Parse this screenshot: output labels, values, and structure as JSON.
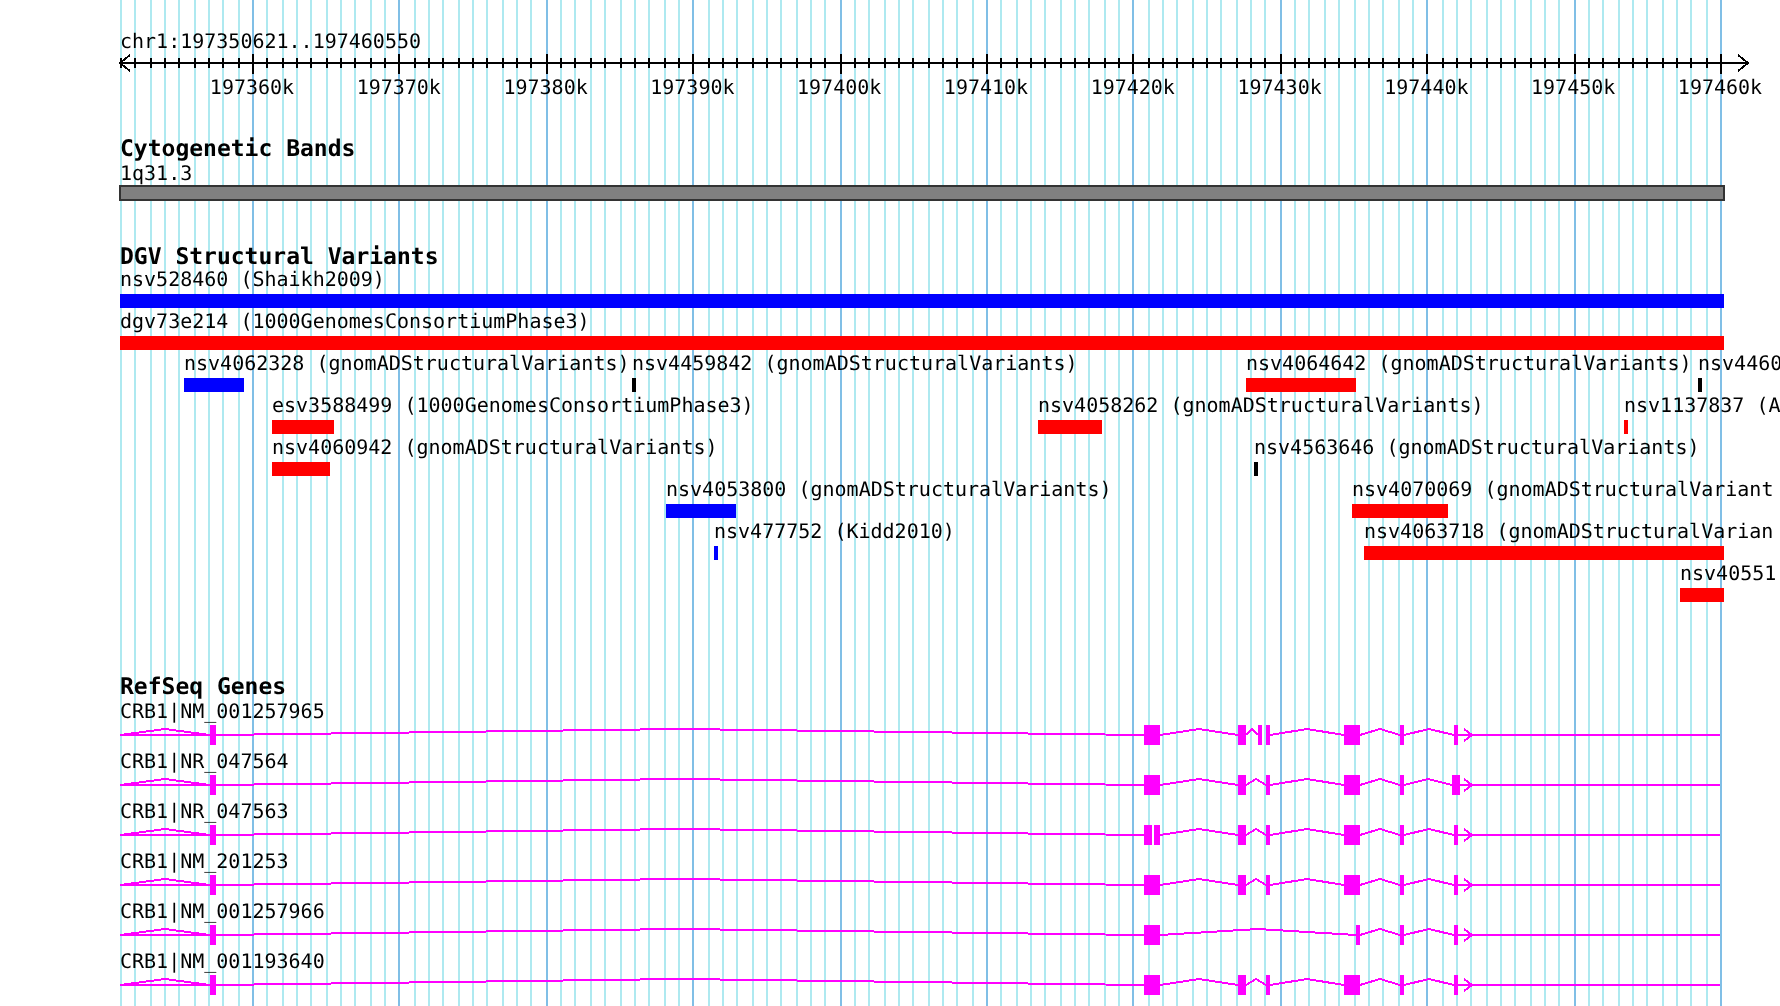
{
  "ruler": {
    "location": "chr1:197350621..197460550",
    "ticks": [
      "197360k",
      "197370k",
      "197380k",
      "197390k",
      "197400k",
      "197410k",
      "197420k",
      "197430k",
      "197440k",
      "197450k",
      "197460k"
    ]
  },
  "tracks": [
    {
      "kind": "cytoband",
      "title": "Cytogenetic Bands",
      "band": "1q31.3"
    },
    {
      "kind": "variants",
      "title": "DGV Structural Variants",
      "features": [
        {
          "label": "nsv528460 (Shaikh2009)",
          "color": "#0000ff"
        },
        {
          "label": "dgv73e214 (1000GenomesConsortiumPhase3)",
          "color": "#ff0000"
        },
        {
          "label": "nsv4062328 (gnomADStructuralVariants)",
          "color": "#0000ff"
        },
        {
          "label": "nsv4459842 (gnomADStructuralVariants)",
          "color": "#000000"
        },
        {
          "label": "nsv4064642 (gnomADStructuralVariants)",
          "color": "#ff0000"
        },
        {
          "label": "nsv4460",
          "color": "#000000"
        },
        {
          "label": "esv3588499 (1000GenomesConsortiumPhase3)",
          "color": "#ff0000"
        },
        {
          "label": "nsv4058262 (gnomADStructuralVariants)",
          "color": "#ff0000"
        },
        {
          "label": "nsv1137837 (A",
          "color": "#ff0000"
        },
        {
          "label": "nsv4060942 (gnomADStructuralVariants)",
          "color": "#ff0000"
        },
        {
          "label": "nsv4563646 (gnomADStructuralVariants)",
          "color": "#000000"
        },
        {
          "label": "nsv4053800 (gnomADStructuralVariants)",
          "color": "#0000ff"
        },
        {
          "label": "nsv4070069 (gnomADStructuralVariant",
          "color": "#ff0000"
        },
        {
          "label": "nsv477752 (Kidd2010)",
          "color": "#0000ff"
        },
        {
          "label": "nsv4063718 (gnomADStructuralVarian",
          "color": "#ff0000"
        },
        {
          "label": "nsv40551",
          "color": "#ff0000"
        }
      ]
    },
    {
      "kind": "genes",
      "title": "RefSeq Genes",
      "transcripts": [
        {
          "label": "CRB1|NM_001257965"
        },
        {
          "label": "CRB1|NR_047564"
        },
        {
          "label": "CRB1|NR_047563"
        },
        {
          "label": "CRB1|NM_201253"
        },
        {
          "label": "CRB1|NM_001257966"
        },
        {
          "label": "CRB1|NM_001193640"
        }
      ]
    }
  ]
}
